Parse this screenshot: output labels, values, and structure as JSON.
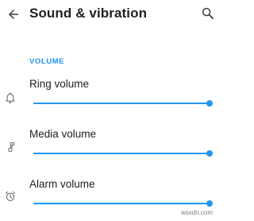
{
  "header": {
    "title": "Sound & vibration",
    "back_icon": "back-arrow-icon",
    "search_icon": "search-icon"
  },
  "section": {
    "title": "VOLUME"
  },
  "volumes": [
    {
      "label": "Ring volume",
      "icon": "bell-icon",
      "level": 1.0
    },
    {
      "label": "Media volume",
      "icon": "music-note-icon",
      "level": 1.0
    },
    {
      "label": "Alarm volume",
      "icon": "alarm-clock-icon",
      "level": 1.0
    }
  ],
  "watermark": "wsxdn.com",
  "colors": {
    "accent": "#2196f3",
    "track": "#bfdcf8",
    "icon": "#616161",
    "text": "#202124"
  }
}
